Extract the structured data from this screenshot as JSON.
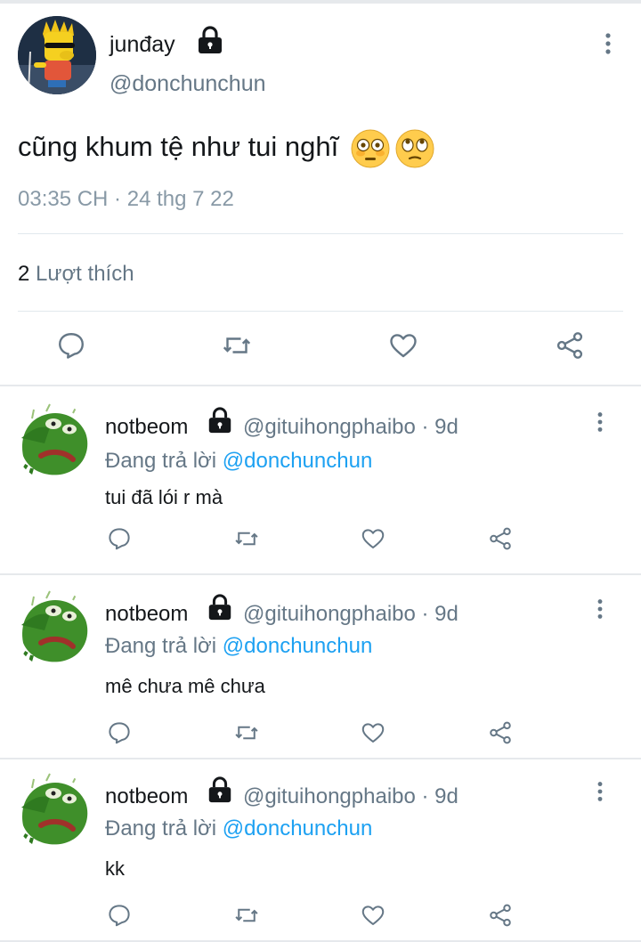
{
  "main_tweet": {
    "display_name": "junđay",
    "handle": "@donchunchun",
    "text": "cũng khum tệ như tui nghĩ",
    "emojis": [
      "flushed-face",
      "face-with-rolling-eyes"
    ],
    "timestamp": "03:35 CH · 24 thg 7 22",
    "like_count": "2",
    "like_label": "Lượt thích",
    "protected": true
  },
  "replies": [
    {
      "display_name": "notbeom",
      "handle": "@gituihongphaibo · 9d",
      "replying_prefix": "Đang trả lời ",
      "replying_to": "@donchunchun",
      "text": "tui đã lói r mà",
      "protected": true
    },
    {
      "display_name": "notbeom",
      "handle": "@gituihongphaibo · 9d",
      "replying_prefix": "Đang trả lời ",
      "replying_to": "@donchunchun",
      "text": "mê chưa mê chưa",
      "protected": true
    },
    {
      "display_name": "notbeom",
      "handle": "@gituihongphaibo · 9d",
      "replying_prefix": "Đang trả lời ",
      "replying_to": "@donchunchun",
      "text": "kk",
      "protected": true
    }
  ],
  "icons": {
    "reply": "reply-icon",
    "retweet": "retweet-icon",
    "like": "heart-icon",
    "share": "share-icon",
    "more": "more-vertical-icon",
    "protected": "lock-icon"
  },
  "colors": {
    "text": "#14171a",
    "secondary": "#657786",
    "link": "#1da1f2",
    "icon": "#657786",
    "separator": "#e1e8ed"
  }
}
